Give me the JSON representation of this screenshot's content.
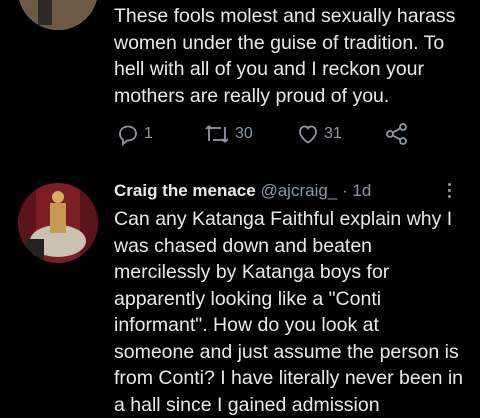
{
  "tweet1": {
    "lines": [
      "These fools molest and sexually harass",
      "women under the guise of tradition. To",
      "hell with all of you and I reckon your",
      "mothers are really proud of you."
    ],
    "replies": "1",
    "retweets": "30",
    "likes": "31"
  },
  "tweet2": {
    "display_name": "Craig the menace",
    "handle": "@ajcraig_",
    "separator": "·",
    "time": "1d",
    "lines": [
      "Can any Katanga Faithful explain why I",
      "was chased down and beaten",
      "mercilessly by Katanga boys for",
      "apparently looking like a \"Conti",
      "informant\". How do you look at",
      "someone and just assume the person is",
      "from Conti? I have literally never been in",
      "a hall since I gained admission"
    ]
  },
  "icons": {
    "reply": "reply-icon",
    "retweet": "retweet-icon",
    "like": "heart-icon",
    "share": "share-icon",
    "more": "more-vertical-icon"
  },
  "colors": {
    "background": "#000000",
    "text": "#e7e9ea",
    "muted": "#8b98a5"
  }
}
